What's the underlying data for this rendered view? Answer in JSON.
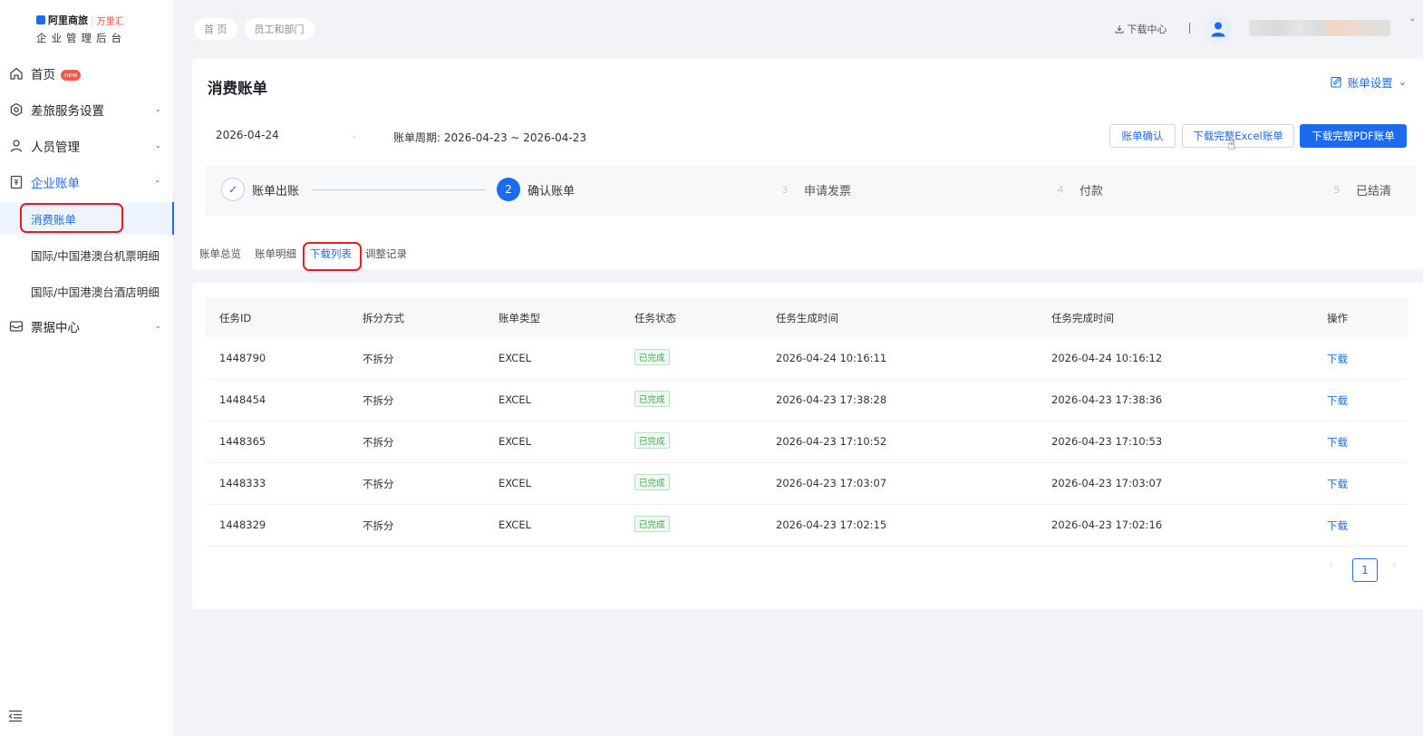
{
  "logo": {
    "brand": "阿里商旅",
    "partner": "万里汇",
    "subtitle": "企业管理后台"
  },
  "sidebar": {
    "home": {
      "label": "首页",
      "badge": "new"
    },
    "travel_settings": {
      "label": "差旅服务设置"
    },
    "people": {
      "label": "人员管理"
    },
    "enterprise_bill": {
      "label": "企业账单"
    },
    "sub_items": [
      {
        "label": "消费账单"
      },
      {
        "label": "国际/中国港澳台机票明细"
      },
      {
        "label": "国际/中国港澳台酒店明细"
      }
    ],
    "invoice_center": {
      "label": "票据中心"
    }
  },
  "breadcrumb": [
    "首 页",
    "员工和部门"
  ],
  "topbar": {
    "download_center": "下载中心",
    "separator": "|"
  },
  "bill": {
    "title": "消费账单",
    "settings_label": "账单设置",
    "date_value": "2026-04-24",
    "period_label": "账单周期: 2026-04-23 ~ 2026-04-23",
    "confirm_btn": "账单确认",
    "excel_btn": "下载完整Excel账单",
    "pdf_btn": "下载完整PDF账单"
  },
  "steps": [
    {
      "num": "✓",
      "label": "账单出账",
      "state": "done"
    },
    {
      "num": "2",
      "label": "确认账单",
      "state": "active"
    },
    {
      "num": "3",
      "label": "申请发票",
      "state": "wait"
    },
    {
      "num": "4",
      "label": "付款",
      "state": "wait"
    },
    {
      "num": "5",
      "label": "已结清",
      "state": "wait"
    }
  ],
  "tabs": [
    "账单总览",
    "账单明细",
    "下载列表",
    "调整记录"
  ],
  "active_tab": "下载列表",
  "table": {
    "headers": [
      "任务ID",
      "拆分方式",
      "账单类型",
      "任务状态",
      "任务生成时间",
      "任务完成时间",
      "操作"
    ],
    "rows": [
      {
        "id": "1448790",
        "split": "不拆分",
        "type": "EXCEL",
        "status": "已完成",
        "created": "2026-04-24 10:16:11",
        "finished": "2026-04-24 10:16:12",
        "action": "下载"
      },
      {
        "id": "1448454",
        "split": "不拆分",
        "type": "EXCEL",
        "status": "已完成",
        "created": "2026-04-23 17:38:28",
        "finished": "2026-04-23 17:38:36",
        "action": "下载"
      },
      {
        "id": "1448365",
        "split": "不拆分",
        "type": "EXCEL",
        "status": "已完成",
        "created": "2026-04-23 17:10:52",
        "finished": "2026-04-23 17:10:53",
        "action": "下载"
      },
      {
        "id": "1448333",
        "split": "不拆分",
        "type": "EXCEL",
        "status": "已完成",
        "created": "2026-04-23 17:03:07",
        "finished": "2026-04-23 17:03:07",
        "action": "下载"
      },
      {
        "id": "1448329",
        "split": "不拆分",
        "type": "EXCEL",
        "status": "已完成",
        "created": "2026-04-23 17:02:15",
        "finished": "2026-04-23 17:02:16",
        "action": "下载"
      }
    ]
  },
  "pagination": {
    "current": "1",
    "prev": "‹",
    "next": "›"
  },
  "colors": {
    "primary": "#1a6bf0",
    "highlight": "#e02020",
    "success": "#3aa757"
  }
}
